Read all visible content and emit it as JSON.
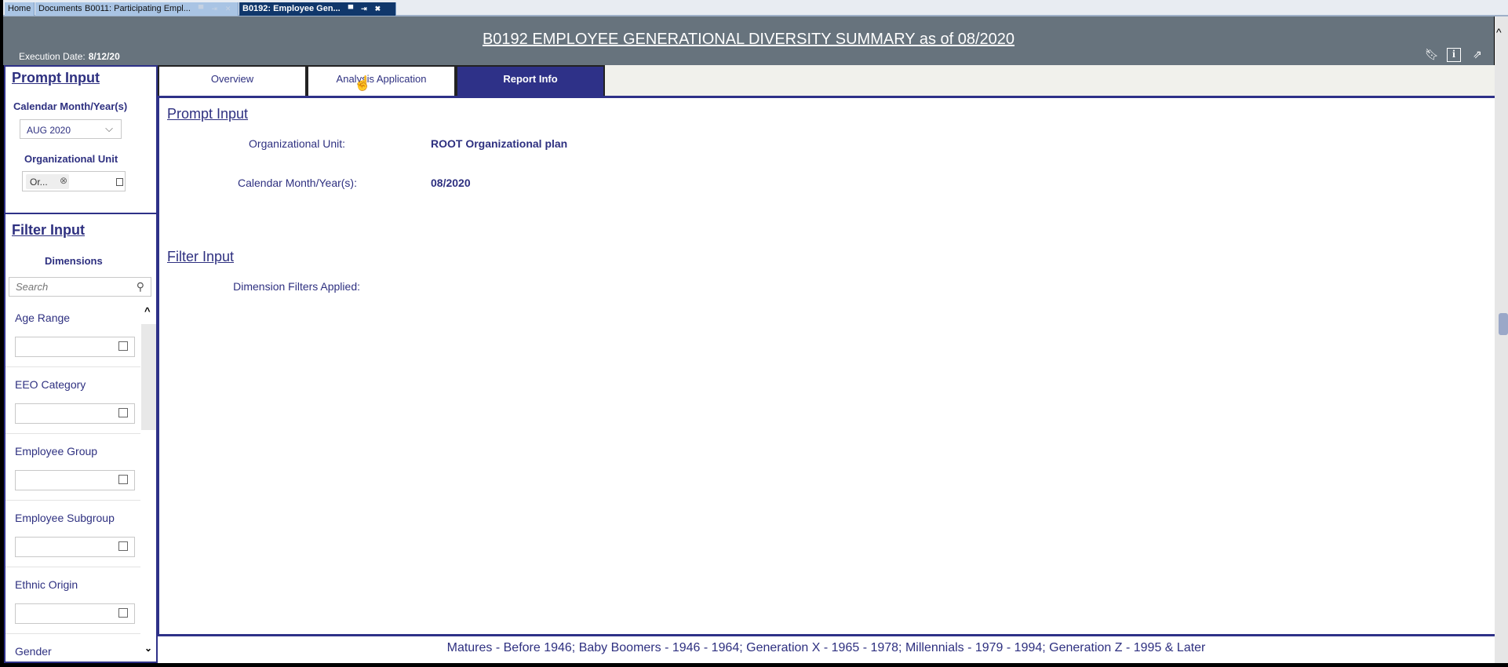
{
  "window_tabs": [
    {
      "label": "Home"
    },
    {
      "label": "Documents"
    },
    {
      "label": "B0011: Participating Empl..."
    },
    {
      "label": "B0192: Employee Gen..."
    }
  ],
  "header": {
    "title": "B0192 EMPLOYEE GENERATIONAL DIVERSITY SUMMARY as of 08/2020",
    "exec_label": "Execution Date:",
    "exec_value": "8/12/20"
  },
  "left": {
    "prompt_title": "Prompt Input",
    "calendar_label": "Calendar Month/Year(s)",
    "calendar_value": "AUG 2020",
    "org_label": "Organizational Unit",
    "org_token": "Or...",
    "filter_title": "Filter Input",
    "dimensions_label": "Dimensions",
    "search_placeholder": "Search",
    "dimensions": [
      {
        "label": "Age Range"
      },
      {
        "label": "EEO Category"
      },
      {
        "label": "Employee Group"
      },
      {
        "label": "Employee Subgroup"
      },
      {
        "label": "Ethnic Origin"
      },
      {
        "label": "Gender"
      }
    ]
  },
  "tabs": [
    {
      "label": "Overview"
    },
    {
      "label": "Analysis Application"
    },
    {
      "label": "Report Info"
    }
  ],
  "main": {
    "prompt_title": "Prompt Input",
    "org_label": "Organizational Unit:",
    "org_value": "ROOT Organizational plan",
    "cal_label": "Calendar Month/Year(s):",
    "cal_value": "08/2020",
    "filter_title": "Filter Input",
    "dim_label": "Dimension Filters Applied:"
  },
  "footer": {
    "text": "Matures - Before 1946; Baby Boomers - 1946 - 1964; Generation X - 1965 - 1978; Millennials - 1979 - 1994; Generation Z - 1995 & Later"
  },
  "colors": {
    "accent": "#2e3188",
    "header": "#67737d"
  }
}
